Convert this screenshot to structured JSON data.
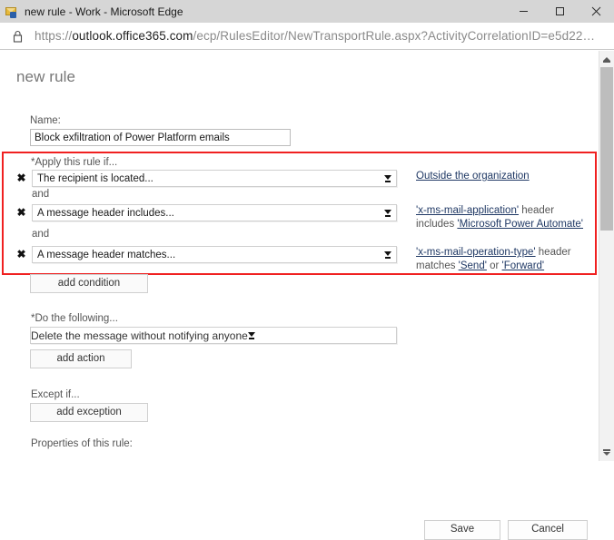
{
  "window": {
    "title": "new rule - Work - Microsoft Edge",
    "favicon": "mail-rule-icon",
    "controls": {
      "minimize": "minimize-icon",
      "maximize": "maximize-icon",
      "close": "close-icon"
    }
  },
  "address_bar": {
    "lock_icon": "lock-icon",
    "url_prefix": "https://",
    "url_host": "outlook.office365.com",
    "url_path": "/ecp/RulesEditor/NewTransportRule.aspx?ActivityCorrelationID=e5d22…"
  },
  "page": {
    "title": "new rule",
    "name_label": "Name:",
    "name_value": "Block exfiltration of Power Platform emails",
    "apply_label": "*Apply this rule if...",
    "and_1": "and",
    "and_2": "and",
    "conditions": [
      {
        "select_value": "The recipient is located...",
        "link_parts": [
          {
            "text": "Outside the organization",
            "link": true
          }
        ]
      },
      {
        "select_value": "A message header includes...",
        "link_parts": [
          {
            "text": "'x-ms-mail-application'",
            "link": true
          },
          {
            "text": " header includes ",
            "link": false
          },
          {
            "text": "'Microsoft Power Automate'",
            "link": true
          }
        ]
      },
      {
        "select_value": "A message header matches...",
        "link_parts": [
          {
            "text": "'x-ms-mail-operation-type'",
            "link": true
          },
          {
            "text": " header matches ",
            "link": false
          },
          {
            "text": "'Send'",
            "link": true
          },
          {
            "text": " or ",
            "link": false
          },
          {
            "text": "'Forward'",
            "link": true
          }
        ]
      }
    ],
    "add_condition_label": "add condition",
    "do_following_label": "*Do the following...",
    "action_value": "Delete the message without notifying anyone",
    "add_action_label": "add action",
    "except_label": "Except if...",
    "add_exception_label": "add exception",
    "properties_label": "Properties of this rule:",
    "save_label": "Save",
    "cancel_label": "Cancel"
  },
  "colors": {
    "annotation": "#f02020",
    "link": "#1f3864",
    "titlebar": "#d6d6d6",
    "scroll_thumb": "#bdbdbd"
  }
}
